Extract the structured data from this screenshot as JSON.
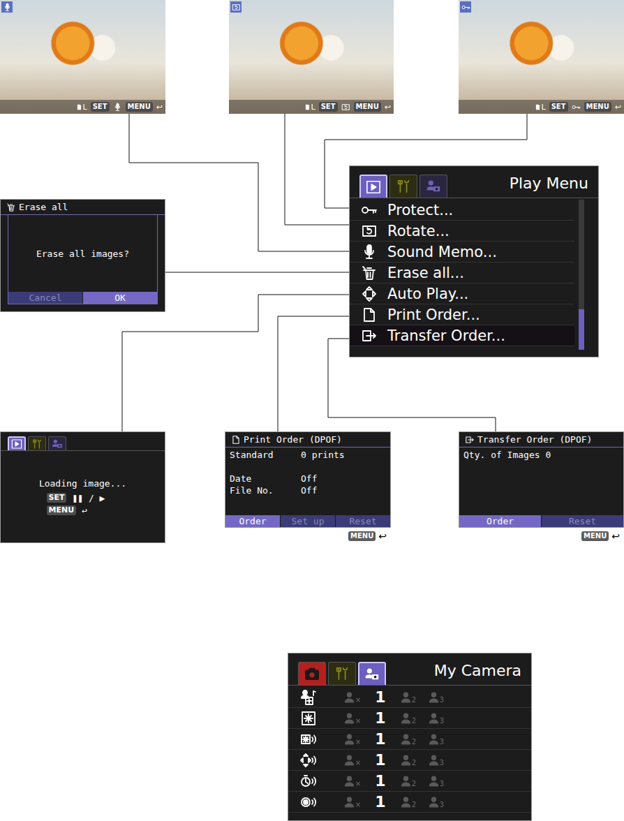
{
  "photo_screens": [
    {
      "kind": "sound-memo",
      "size": "L",
      "set_key": "SET",
      "menu_key": "MENU",
      "back": "↩"
    },
    {
      "kind": "rotate",
      "size": "L",
      "set_key": "SET",
      "menu_key": "MENU",
      "back": "↩"
    },
    {
      "kind": "protect",
      "size": "L",
      "set_key": "SET",
      "menu_key": "MENU",
      "back": "↩"
    }
  ],
  "play_menu": {
    "tabs": [
      {
        "kind": "play",
        "selected": true
      },
      {
        "kind": "setup",
        "selected": false
      },
      {
        "kind": "my-camera",
        "selected": false
      }
    ],
    "title": "Play Menu",
    "items": [
      {
        "kind": "protect",
        "label": "Protect...",
        "selected": false
      },
      {
        "kind": "rotate",
        "label": "Rotate...",
        "selected": false
      },
      {
        "kind": "sound-memo",
        "label": "Sound Memo...",
        "selected": false
      },
      {
        "kind": "erase-all",
        "label": "Erase all...",
        "selected": false
      },
      {
        "kind": "auto-play",
        "label": "Auto Play...",
        "selected": false
      },
      {
        "kind": "print-order",
        "label": "Print Order...",
        "selected": false
      },
      {
        "kind": "transfer-order",
        "label": "Transfer Order...",
        "selected": true
      }
    ],
    "scrollbar": {
      "level": 0.27
    }
  },
  "erase_dialog": {
    "title": "Erase all",
    "message": "Erase all images?",
    "buttons": [
      {
        "label": "Cancel",
        "selected": false
      },
      {
        "label": "OK",
        "selected": true
      }
    ]
  },
  "auto_play_screen": {
    "tabs": [
      {
        "kind": "play",
        "selected": true
      },
      {
        "kind": "setup",
        "selected": false
      },
      {
        "kind": "my-camera",
        "selected": false
      }
    ],
    "message": "Loading image...",
    "keys": [
      {
        "key": "SET",
        "action": "❚❚ / ▶"
      },
      {
        "key": "MENU",
        "action": "↩"
      }
    ]
  },
  "print_order_screen": {
    "title": "Print Order (DPOF)",
    "rows": [
      {
        "label": "Standard",
        "value": "0 prints"
      },
      {
        "label": "Date",
        "value": "Off"
      },
      {
        "label": "File No.",
        "value": "Off"
      }
    ],
    "buttons": [
      {
        "label": "Order",
        "selected": true
      },
      {
        "label": "Set up",
        "selected": false
      },
      {
        "label": "Reset",
        "selected": false
      }
    ],
    "menu_key": "MENU",
    "back": "↩"
  },
  "transfer_order_screen": {
    "title": "Transfer Order (DPOF)",
    "rows": [
      {
        "label": "Qty. of Images",
        "value": "0"
      }
    ],
    "buttons": [
      {
        "label": "Order",
        "selected": true
      },
      {
        "label": "Reset",
        "selected": false
      }
    ],
    "menu_key": "MENU",
    "back": "↩"
  },
  "my_camera_menu": {
    "tabs": [
      {
        "kind": "camera",
        "selected": false
      },
      {
        "kind": "setup",
        "selected": false
      },
      {
        "kind": "my-camera",
        "selected": true
      }
    ],
    "title": "My Camera",
    "rows": [
      {
        "kind": "theme",
        "options": [
          {
            "label": "×",
            "selected": false
          },
          {
            "label": "1",
            "selected": true
          },
          {
            "label": "2",
            "selected": false
          },
          {
            "label": "3",
            "selected": false
          }
        ]
      },
      {
        "kind": "start-image",
        "options": [
          {
            "label": "×",
            "selected": false
          },
          {
            "label": "1",
            "selected": true
          },
          {
            "label": "2",
            "selected": false
          },
          {
            "label": "3",
            "selected": false
          }
        ]
      },
      {
        "kind": "start-sound",
        "options": [
          {
            "label": "×",
            "selected": false
          },
          {
            "label": "1",
            "selected": true
          },
          {
            "label": "2",
            "selected": false
          },
          {
            "label": "3",
            "selected": false
          }
        ]
      },
      {
        "kind": "operation-sound",
        "options": [
          {
            "label": "×",
            "selected": false
          },
          {
            "label": "1",
            "selected": true
          },
          {
            "label": "2",
            "selected": false
          },
          {
            "label": "3",
            "selected": false
          }
        ]
      },
      {
        "kind": "selftimer-sound",
        "options": [
          {
            "label": "×",
            "selected": false
          },
          {
            "label": "1",
            "selected": true
          },
          {
            "label": "2",
            "selected": false
          },
          {
            "label": "3",
            "selected": false
          }
        ]
      },
      {
        "kind": "shutter-sound",
        "options": [
          {
            "label": "×",
            "selected": false
          },
          {
            "label": "1",
            "selected": true
          },
          {
            "label": "2",
            "selected": false
          },
          {
            "label": "3",
            "selected": false
          }
        ]
      }
    ]
  }
}
